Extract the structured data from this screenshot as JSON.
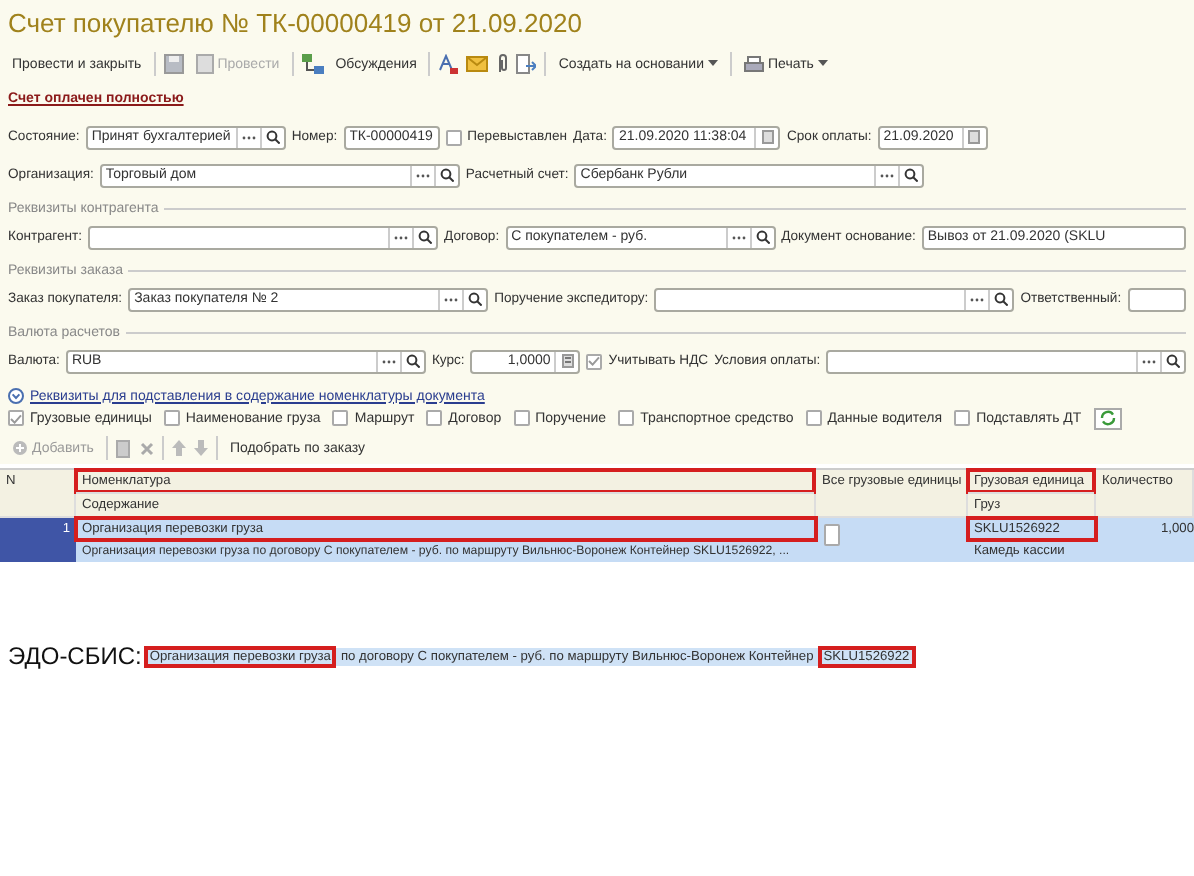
{
  "window": {
    "title": "Счет покупателю № ТК-00000419 от 21.09.2020"
  },
  "toolbar": [
    {
      "label": "Провести и закрыть",
      "disabled": false,
      "menu": false
    },
    {
      "label": "Провести",
      "disabled": true,
      "menu": false
    },
    {
      "label": "Обсуждения",
      "disabled": false,
      "menu": false
    },
    {
      "label": "Создать на основании",
      "disabled": false,
      "menu": true
    },
    {
      "label": "Печать",
      "disabled": false,
      "menu": true
    }
  ],
  "paid_link": "Счет оплачен полностью",
  "groups": [
    {
      "rows": [
        {
          "fields": [
            {
              "label": "Состояние:",
              "kind": "lookup",
              "value": "Принят бухгалтерией"
            },
            {
              "label": "Номер:",
              "kind": "text",
              "value": "ТК-00000419"
            },
            {
              "label": "Перевыставлен",
              "kind": "checkbox",
              "checked": false
            },
            {
              "label": "Дата:",
              "kind": "date",
              "value": "21.09.2020 11:38:04"
            },
            {
              "label": "Срок оплаты:",
              "kind": "date",
              "value": "21.09.2020"
            }
          ]
        },
        {
          "fields": [
            {
              "label": "Организация:",
              "kind": "lookup",
              "value": "Торговый дом"
            },
            {
              "label": "Расчетный счет:",
              "kind": "lookup",
              "value": "Сбербанк Рубли"
            }
          ]
        }
      ]
    },
    {
      "title": "Реквизиты контрагента",
      "rows": [
        {
          "fields": [
            {
              "label": "Контрагент:",
              "kind": "lookup"
            },
            {
              "label": "Договор:",
              "kind": "lookup",
              "value": "С покупателем - руб."
            },
            {
              "label": "Документ основание:",
              "kind": "text",
              "value": "Вывоз от 21.09.2020 (SKLU"
            }
          ]
        }
      ]
    },
    {
      "title": "Реквизиты заказа",
      "rows": [
        {
          "fields": [
            {
              "label": "Заказ покупателя:",
              "kind": "lookup",
              "value": "Заказ покупателя № 2"
            },
            {
              "label": "Поручение экспедитору:",
              "kind": "lookup"
            },
            {
              "label": "Ответственный:",
              "kind": "text"
            }
          ]
        }
      ]
    },
    {
      "title": "Валюта расчетов",
      "rows": [
        {
          "fields": [
            {
              "label": "Валюта:",
              "kind": "lookup",
              "value": "RUB"
            },
            {
              "label": "Курс:",
              "kind": "number",
              "value": "1,0000"
            },
            {
              "label": "Учитывать НДС",
              "kind": "checkbox",
              "checked": true
            },
            {
              "label": "Условия оплаты:",
              "kind": "lookup"
            }
          ]
        }
      ]
    }
  ],
  "options_link": "Реквизиты для подставления в содержание номенклатуры документа",
  "options": [
    {
      "label": "Грузовые единицы",
      "checked": true
    },
    {
      "label": "Наименование груза",
      "checked": false
    },
    {
      "label": "Маршрут",
      "checked": false
    },
    {
      "label": "Договор",
      "checked": false
    },
    {
      "label": "Поручение",
      "checked": false
    },
    {
      "label": "Транспортное средство",
      "checked": false
    },
    {
      "label": "Данные водителя",
      "checked": false
    },
    {
      "label": "Подставлять ДТ",
      "checked": false
    }
  ],
  "table_toolbar": {
    "add": "Добавить",
    "pick": "Подобрать по заказу"
  },
  "table": {
    "columns": [
      {
        "top": "N",
        "highlighted": false
      },
      {
        "top": "Номенклатура",
        "bottom": "Содержание",
        "highlighted": true
      },
      {
        "top": "Все грузовые единицы",
        "highlighted": false
      },
      {
        "top": "Грузовая единица",
        "bottom": "Груз",
        "highlighted": true
      },
      {
        "top": "Количество",
        "highlighted": false
      }
    ],
    "rows": [
      {
        "selected": true,
        "n": "1",
        "item": "Организация перевозки груза",
        "item_highlighted": true,
        "content": "Организация перевозки груза  по договору С покупателем - руб. по маршруту Вильнюс-Воронеж Контейнер SKLU1526922, ...",
        "all_units": false,
        "unit": "SKLU1526922",
        "unit_highlighted": true,
        "cargo": "Камедь кассии",
        "quantity": "1,000"
      }
    ]
  },
  "edo": {
    "label": "ЭДО-СБИС:",
    "parts": [
      {
        "text": "Организация перевозки груза",
        "highlighted": true
      },
      {
        "text": "по договору С покупателем - руб. по маршруту Вильнюс-Воронеж Контейнер",
        "highlighted": false
      },
      {
        "text": "SKLU1526922",
        "highlighted": true
      }
    ]
  }
}
